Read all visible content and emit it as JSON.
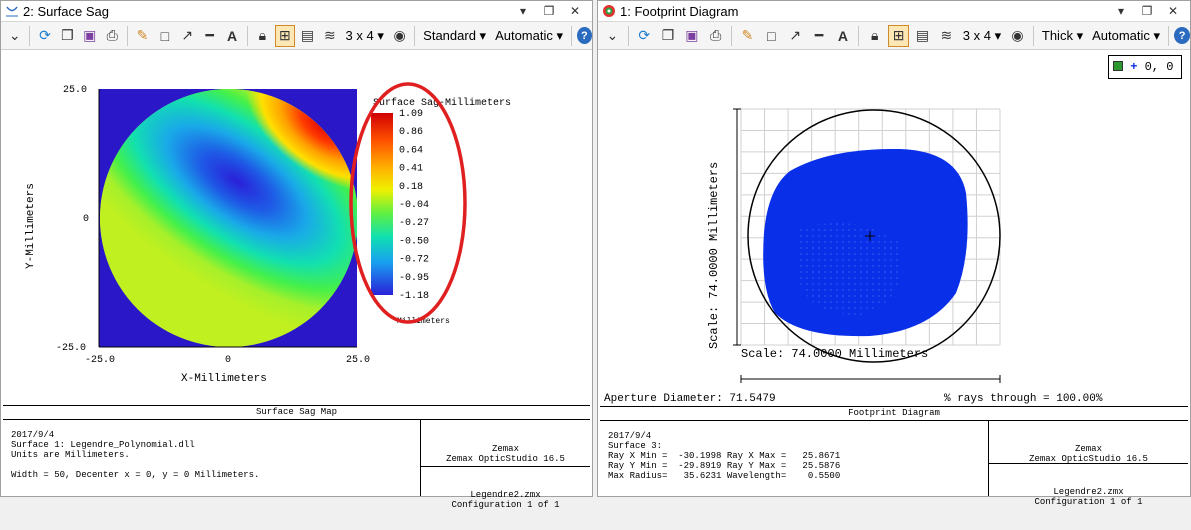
{
  "left_window": {
    "title": "2: Surface Sag",
    "toolbar": {
      "layout": "3 x 4",
      "style": "Standard",
      "scale": "Automatic"
    },
    "plot": {
      "legend_title": "Surface Sag-Millimeters",
      "legend_values": [
        "1.09",
        "0.86",
        "0.64",
        "0.41",
        "0.18",
        "-0.04",
        "-0.27",
        "-0.50",
        "-0.72",
        "-0.95",
        "-1.18"
      ],
      "legend_units": "Millimeters",
      "ylabel": "Y-Millimeters",
      "xlabel": "X-Millimeters",
      "y_ticks": [
        "25.0",
        "0",
        "-25.0"
      ],
      "x_ticks": [
        "-25.0",
        "0",
        "25.0"
      ]
    },
    "footer": {
      "header": "Surface Sag Map",
      "lines": [
        "2017/9/4",
        "Surface 1: Legendre_Polynomial.dll",
        "Units are Millimeters.",
        "",
        "Width = 50, Decenter x = 0, y = 0 Millimeters."
      ],
      "right_top": [
        "Zemax",
        "Zemax OpticStudio 16.5"
      ],
      "right_bottom": [
        "Legendre2.zmx",
        "Configuration 1 of 1"
      ]
    }
  },
  "right_window": {
    "title": "1: Footprint Diagram",
    "toolbar": {
      "layout": "3 x 4",
      "style": "Thick",
      "scale": "Automatic"
    },
    "plot": {
      "legend_entry": "0, 0",
      "scale_vertical": "Scale: 74.0000 Millimeters",
      "scale_horizontal": "Scale: 74.0000 Millimeters",
      "aperture": "Aperture Diameter: 71.5479",
      "rays_through": "% rays through = 100.00%"
    },
    "footer": {
      "header": "Footprint Diagram",
      "lines": [
        "2017/9/4",
        "Surface 3:",
        "Ray X Min =  -30.1998 Ray X Max =   25.8671",
        "Ray Y Min =  -29.8919 Ray Y Max =   25.5876",
        "Max Radius=   35.6231 Wavelength=    0.5500"
      ],
      "right_top": [
        "Zemax",
        "Zemax OpticStudio 16.5"
      ],
      "right_bottom": [
        "Legendre2.zmx",
        "Configuration 1 of 1"
      ]
    }
  }
}
